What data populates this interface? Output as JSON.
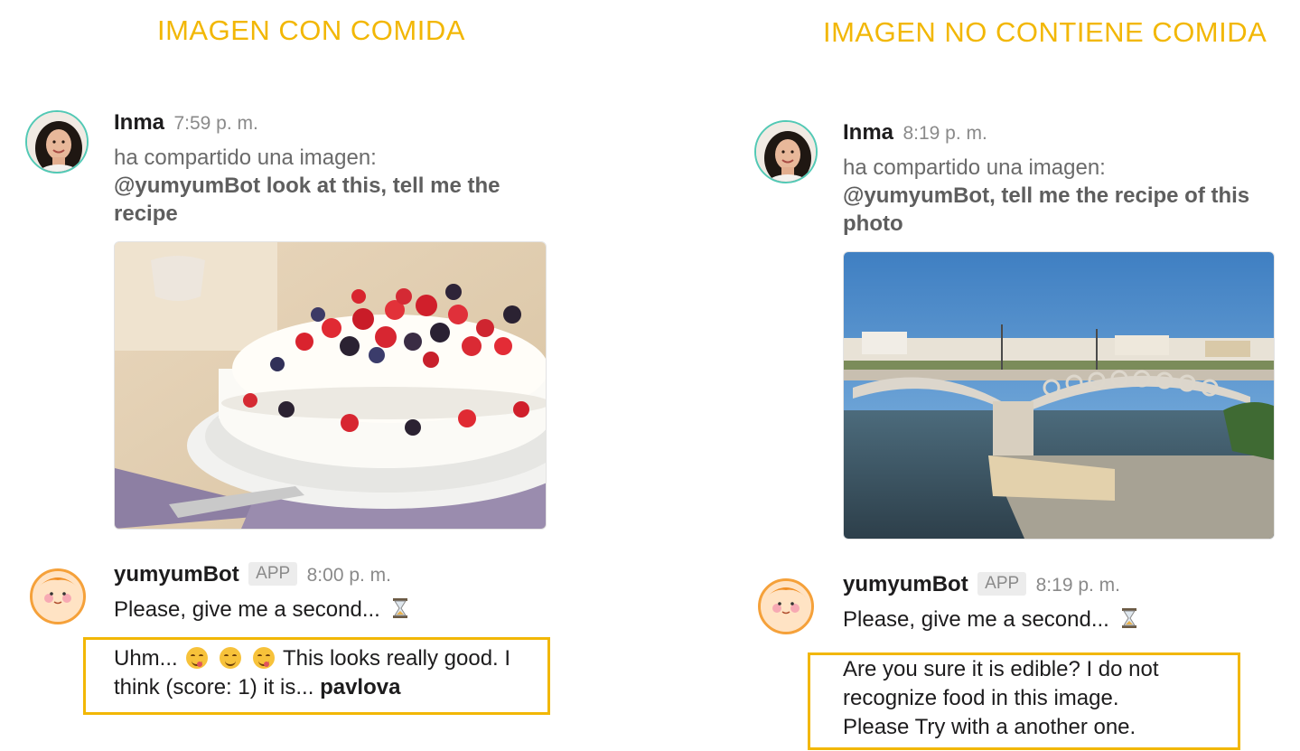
{
  "headings": {
    "left": "IMAGEN CON COMIDA",
    "right": "IMAGEN NO CONTIENE COMIDA"
  },
  "colors": {
    "heading": "#f2b705",
    "box_border": "#f2b705",
    "user_avatar_ring": "#52c9b5",
    "bot_avatar_ring": "#f5a13a"
  },
  "left": {
    "user_message": {
      "author": "Inma",
      "time": "7:59 p. m.",
      "shared_label": "ha compartido una imagen:",
      "comment_line1": "@yumyumBot look at this, tell me the",
      "comment_line2": "recipe",
      "image_icon": "pavlova-photo"
    },
    "bot_message": {
      "author": "yumyumBot",
      "badge": "APP",
      "time": "8:00 p. m.",
      "wait_text": "Please, give me a second...",
      "wait_icon": "hourglass-icon"
    },
    "result": {
      "line1_prefix": "Uhm...",
      "line1_suffix": "This looks really good. I",
      "line2_prefix": "think (score: 1) it is...",
      "line2_bold": "pavlova",
      "emoji_icon": "yum-face-emoji"
    }
  },
  "right": {
    "user_message": {
      "author": "Inma",
      "time": "8:19 p. m.",
      "shared_label": "ha compartido una imagen:",
      "comment_line1": "@yumyumBot, tell me the recipe of this",
      "comment_line2": "photo",
      "image_icon": "bridge-photo"
    },
    "bot_message": {
      "author": "yumyumBot",
      "badge": "APP",
      "time": "8:19 p. m.",
      "wait_text": "Please, give me a second...",
      "wait_icon": "hourglass-icon"
    },
    "result": {
      "line1": "Are you sure it is edible? I do not",
      "line2": "recognize food in this image.",
      "line3": "Please Try with a another one."
    }
  }
}
